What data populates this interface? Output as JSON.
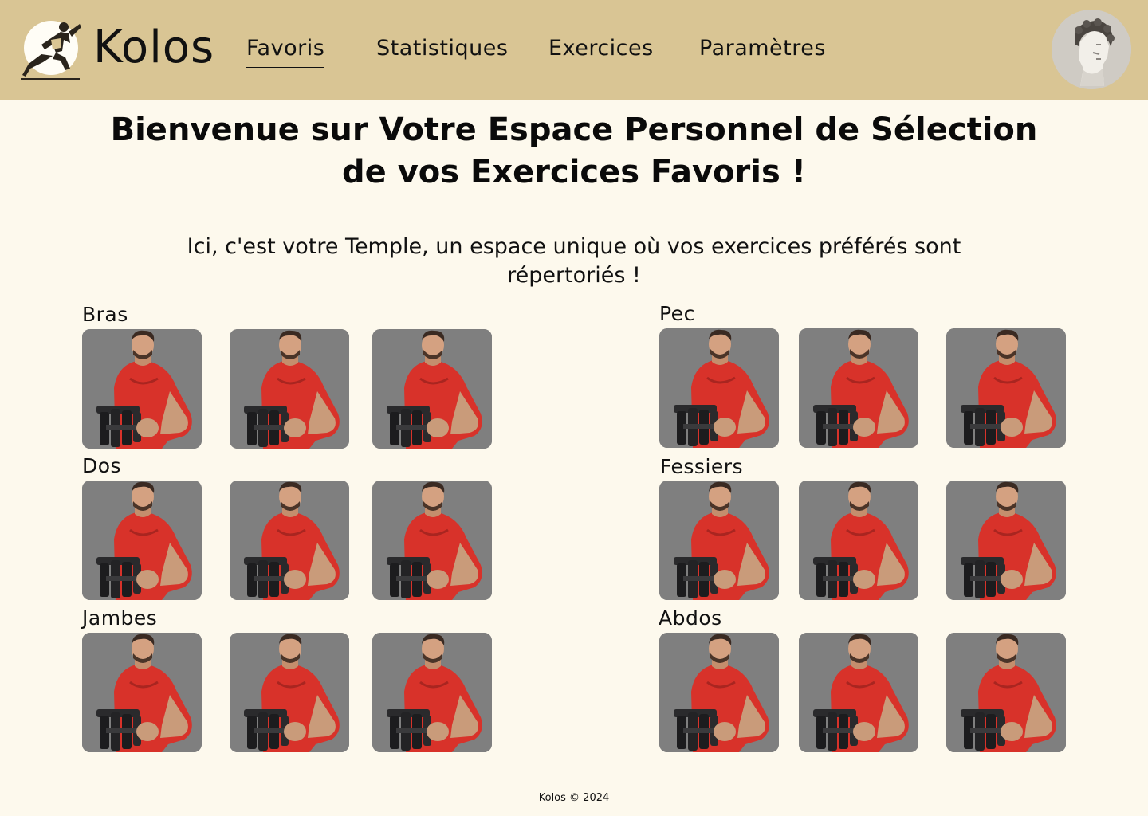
{
  "header": {
    "brand": "Kolos",
    "logo_icon": "runner-logo-icon",
    "avatar_icon": "greek-statue-avatar",
    "nav": [
      {
        "label": "Favoris",
        "active": true
      },
      {
        "label": "Statistiques",
        "active": false
      },
      {
        "label": "Exercices",
        "active": false
      },
      {
        "label": "Paramètres",
        "active": false
      }
    ]
  },
  "main": {
    "title": "Bienvenue sur Votre Espace Personnel de Sélection de vos Exercices Favoris !",
    "subtitle": "Ici, c'est votre Temple, un espace unique où vos exercices préférés sont répertoriés !",
    "categories": [
      {
        "label": "Bras",
        "exercises": 3
      },
      {
        "label": "Pec",
        "exercises": 3
      },
      {
        "label": "Dos",
        "exercises": 3
      },
      {
        "label": "Fessiers",
        "exercises": 3
      },
      {
        "label": "Jambes",
        "exercises": 3
      },
      {
        "label": "Abdos",
        "exercises": 3
      }
    ],
    "tile_image": "athlete-red-shirt-dumbbells"
  },
  "footer": {
    "text": "Kolos © 2024"
  },
  "colors": {
    "header_bg": "#d9c594",
    "page_bg": "#fdf9ed",
    "tile_bg": "#7f7f7f",
    "shirt": "#d8322a"
  }
}
